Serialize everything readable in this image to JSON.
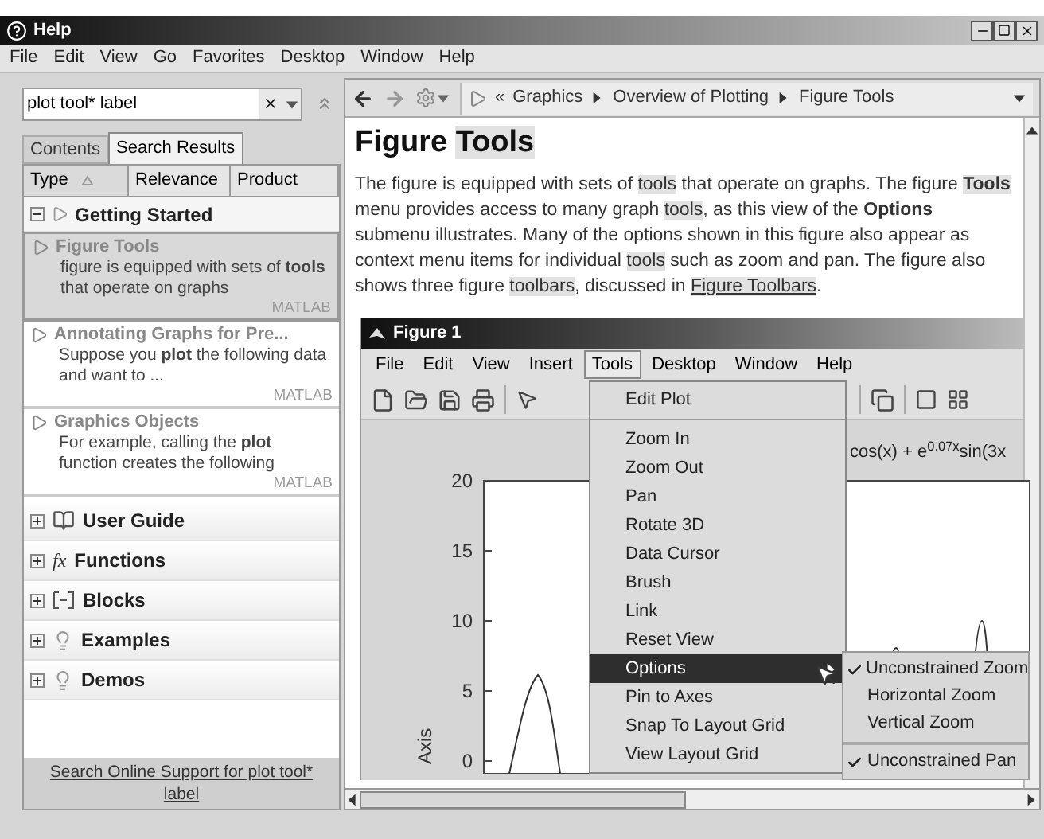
{
  "window": {
    "title": "Help"
  },
  "menu": [
    "File",
    "Edit",
    "View",
    "Go",
    "Favorites",
    "Desktop",
    "Window",
    "Help"
  ],
  "search": {
    "value": "plot tool* label"
  },
  "tabs": [
    {
      "label": "Contents",
      "selected": false
    },
    {
      "label": "Search Results",
      "selected": true
    }
  ],
  "columns": [
    {
      "label": "Type",
      "sorted": true
    },
    {
      "label": "Relevance",
      "sorted": false
    },
    {
      "label": "Product",
      "sorted": false
    }
  ],
  "group": {
    "title": "Getting Started",
    "expanded": true,
    "results": [
      {
        "title": "Figure Tools",
        "snippet": "figure is equipped with sets of **tools** that operate on graphs",
        "product": "MATLAB",
        "selected": true
      },
      {
        "title": "Annotating Graphs for Pre...",
        "snippet": "Suppose you **plot** the following data and want to ...",
        "product": "MATLAB",
        "selected": false
      },
      {
        "title": "Graphics Objects",
        "snippet": "For example, calling the **plot** function creates the following",
        "product": "MATLAB",
        "selected": false
      }
    ]
  },
  "categories": [
    {
      "label": "User Guide",
      "kind": "book",
      "expanded": false
    },
    {
      "label": "Functions",
      "kind": "function",
      "glyph": "fx",
      "expanded": false
    },
    {
      "label": "Blocks",
      "kind": "block",
      "expanded": false
    },
    {
      "label": "Examples",
      "kind": "bulb",
      "expanded": false
    },
    {
      "label": "Demos",
      "kind": "bulb",
      "expanded": false
    }
  ],
  "online_link": "Search Online Support for plot tool* label",
  "breadcrumb": {
    "prefix": "«",
    "items": [
      "Graphics",
      "Overview of Plotting",
      "Figure Tools"
    ]
  },
  "heading": [
    {
      "text": "Figure ",
      "match": false
    },
    {
      "text": "Tools",
      "match": true
    }
  ],
  "paragraph": [
    {
      "kind": "text",
      "text": "The figure is equipped with sets of ",
      "match": false
    },
    {
      "kind": "text",
      "text": "tools",
      "match": true
    },
    {
      "kind": "text",
      "text": " that operate on graphs. The figure ",
      "match": false
    },
    {
      "kind": "text",
      "text": "**Tools**",
      "match": true
    },
    {
      "kind": "text",
      "text": " menu provides access to many graph ",
      "match": false
    },
    {
      "kind": "text",
      "text": "tools",
      "match": true
    },
    {
      "kind": "text",
      "text": ", as this view of the **Options** submenu illustrates. Many of the options shown in this figure also appear as context menu items for individual ",
      "match": false
    },
    {
      "kind": "text",
      "text": "tools",
      "match": true
    },
    {
      "kind": "text",
      "text": " such as zoom and pan. The figure also shows three figure ",
      "match": false
    },
    {
      "kind": "text",
      "text": "toolbars",
      "match": true
    },
    {
      "kind": "text",
      "text": ", discussed in ",
      "match": false
    },
    {
      "kind": "link",
      "text": "Figure Toolbars",
      "match": true
    },
    {
      "kind": "text",
      "text": ".",
      "match": false
    }
  ],
  "figure": {
    "title": "Figure 1",
    "menu": [
      {
        "label": "File",
        "selected": false
      },
      {
        "label": "Edit",
        "selected": false
      },
      {
        "label": "View",
        "selected": false
      },
      {
        "label": "Insert",
        "selected": false
      },
      {
        "label": "Tools",
        "selected": true
      },
      {
        "label": "Desktop",
        "selected": false
      },
      {
        "label": "Window",
        "selected": false
      },
      {
        "label": "Help",
        "selected": false
      }
    ],
    "tools_menu": [
      {
        "kind": "item",
        "label": "Edit Plot",
        "selected": false
      },
      {
        "kind": "separator"
      },
      {
        "kind": "item",
        "label": "Zoom In",
        "selected": false
      },
      {
        "kind": "item",
        "label": "Zoom Out",
        "selected": false
      },
      {
        "kind": "item",
        "label": "Pan",
        "selected": false
      },
      {
        "kind": "item",
        "label": "Rotate 3D",
        "selected": false
      },
      {
        "kind": "item",
        "label": "Data Cursor",
        "selected": false
      },
      {
        "kind": "item",
        "label": "Brush",
        "selected": false
      },
      {
        "kind": "item",
        "label": "Link",
        "selected": false
      },
      {
        "kind": "item",
        "label": "Reset View",
        "selected": false
      },
      {
        "kind": "submenu",
        "label": "Options",
        "selected": true
      },
      {
        "kind": "item",
        "label": "Pin to Axes",
        "selected": false
      },
      {
        "kind": "item",
        "label": "Snap To Layout Grid",
        "selected": false
      },
      {
        "kind": "item",
        "label": "View Layout Grid",
        "selected": false
      }
    ],
    "submenu": [
      {
        "kind": "item",
        "label": "Unconstrained Zoom",
        "checked": true
      },
      {
        "kind": "item",
        "label": "Horizontal Zoom",
        "checked": false
      },
      {
        "kind": "item",
        "label": "Vertical Zoom",
        "checked": false
      },
      {
        "kind": "separator"
      },
      {
        "kind": "item",
        "label": "Unconstrained Pan",
        "checked": true
      }
    ],
    "plot": {
      "title": "cos(x) + e$^{0.07x}$sin(3x",
      "ylabel": "Axis",
      "yticks": [
        "20",
        "15",
        "10",
        "5",
        "0"
      ]
    }
  }
}
